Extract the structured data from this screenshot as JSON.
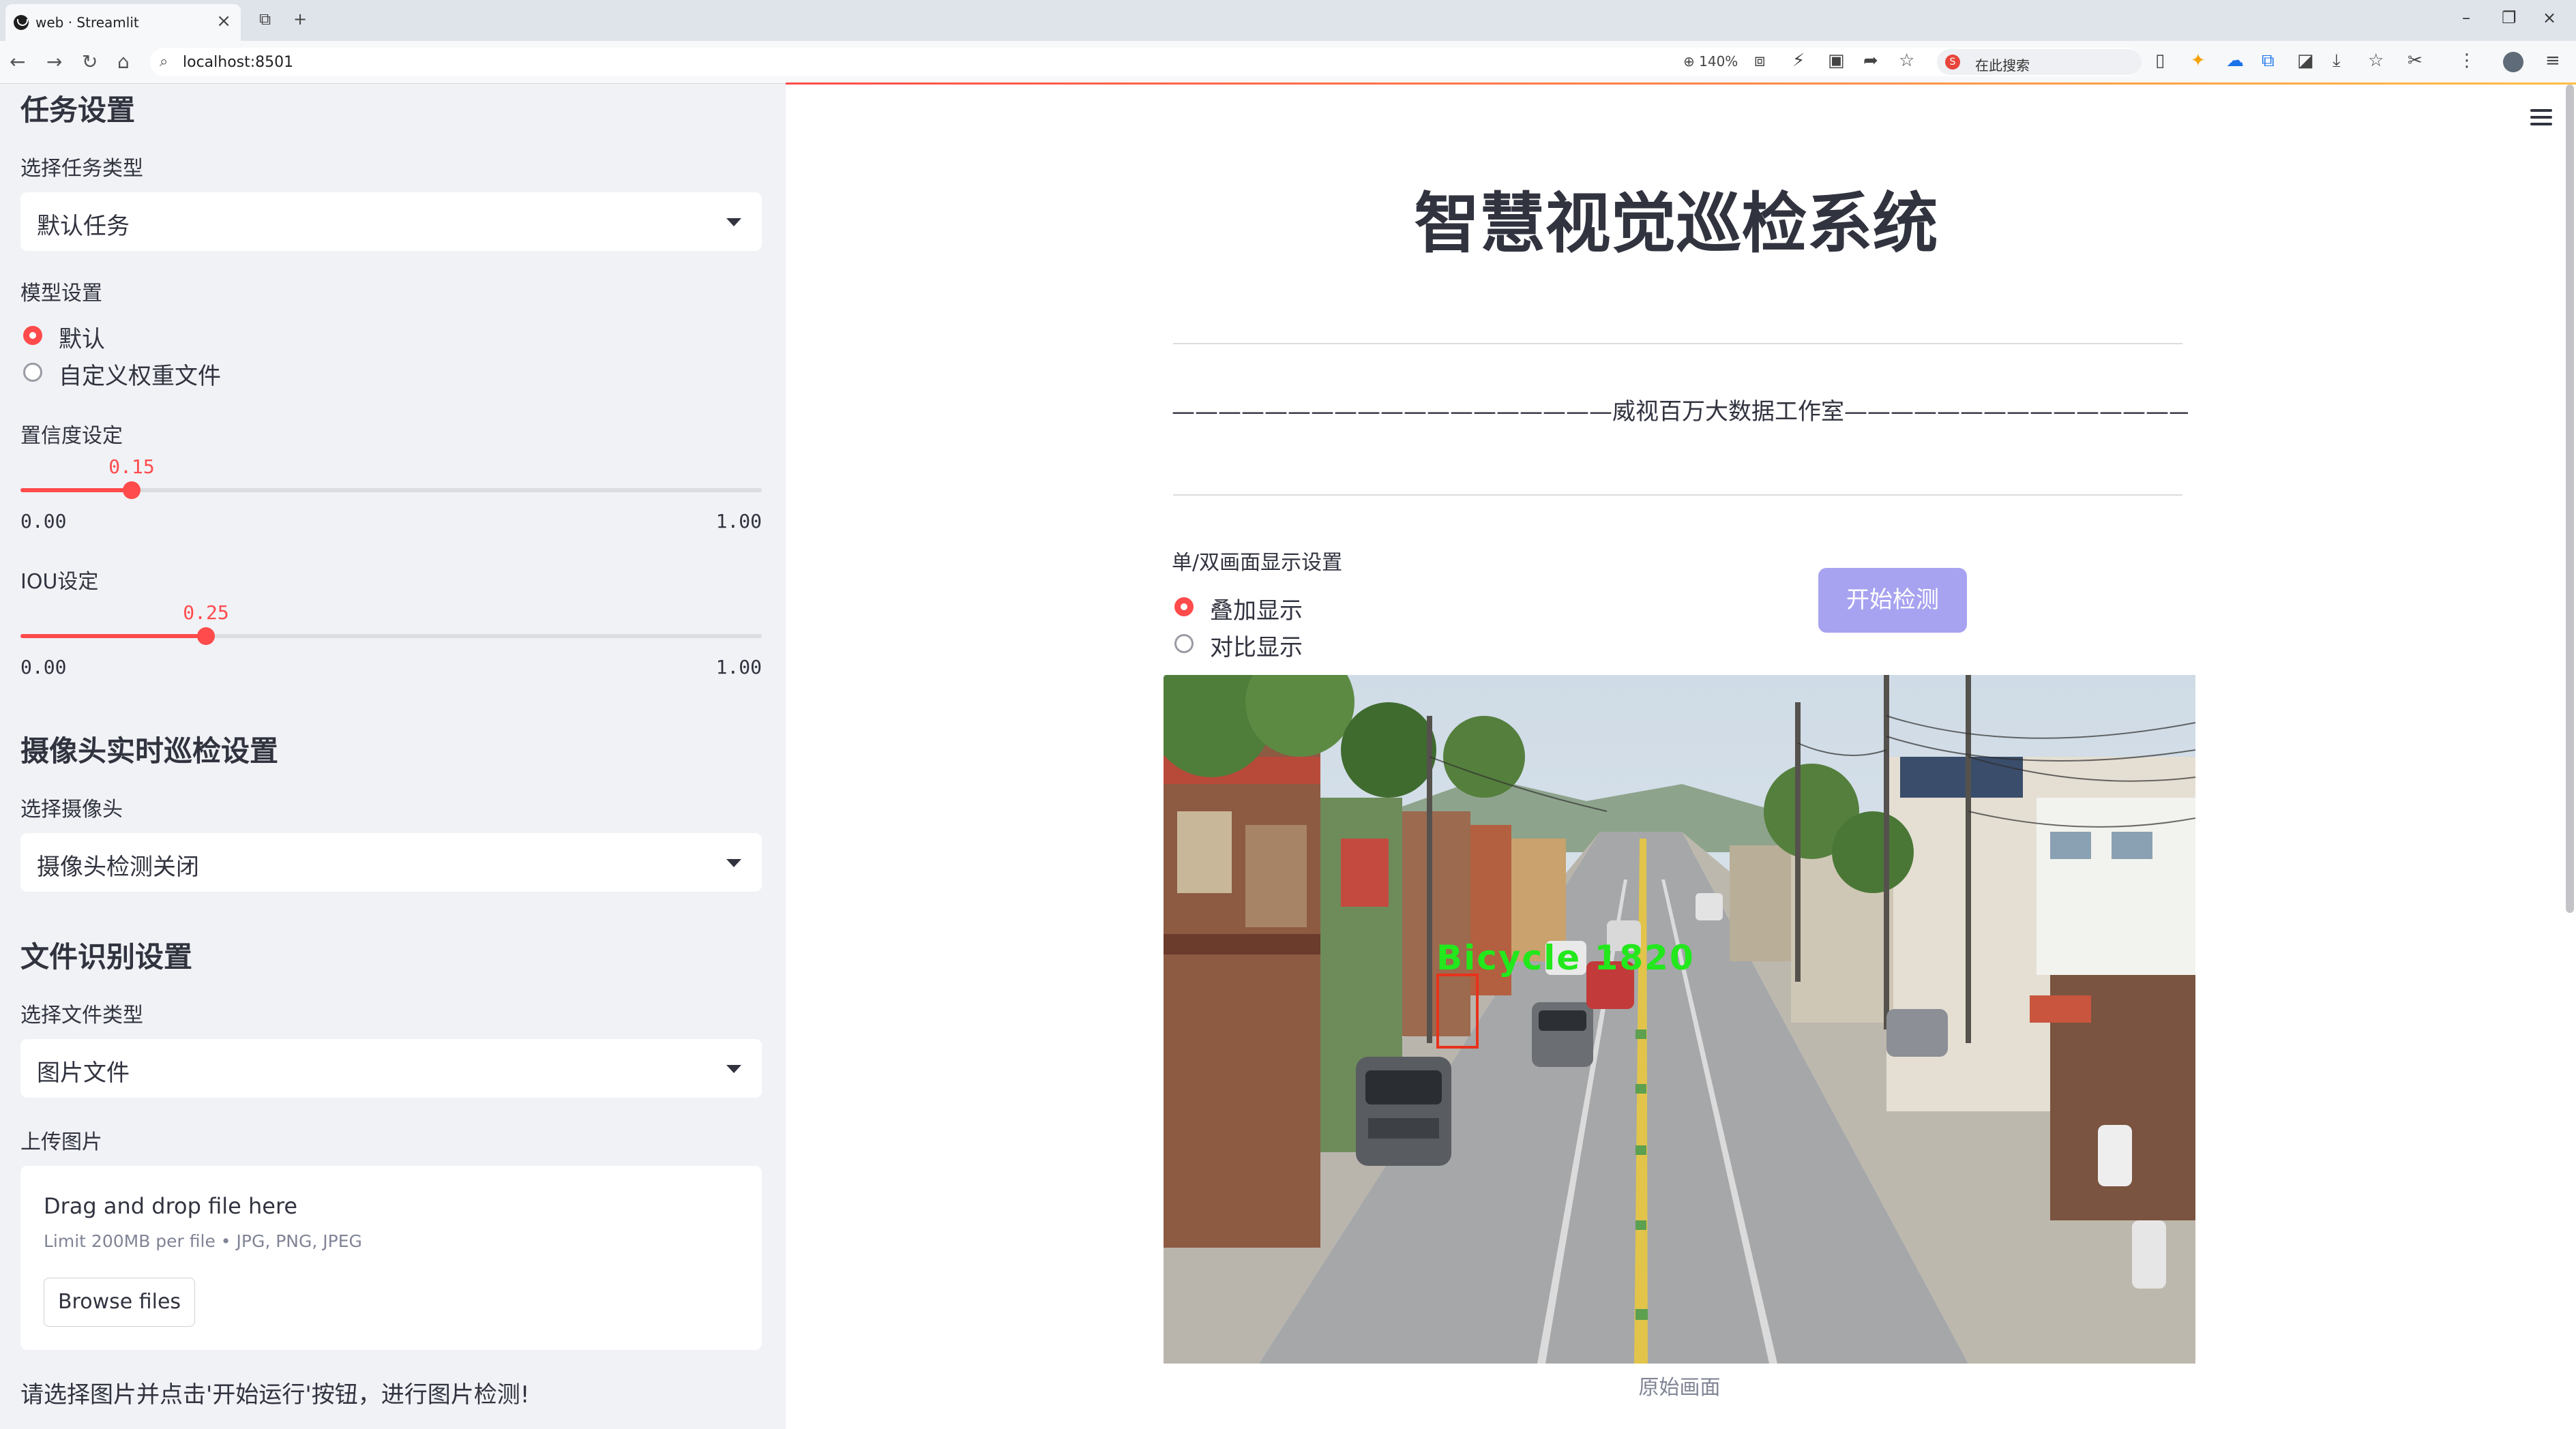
{
  "browser": {
    "tab_title": "web · Streamlit",
    "url": "localhost:8501",
    "zoom": "140%",
    "search_placeholder": "在此搜索"
  },
  "sidebar": {
    "task_heading": "任务设置",
    "task_type_label": "选择任务类型",
    "task_type_value": "默认任务",
    "model_label": "模型设置",
    "model_options": [
      "默认",
      "自定义权重文件"
    ],
    "model_selected": "默认",
    "confidence": {
      "label": "置信度设定",
      "value": "0.15",
      "min": "0.00",
      "max": "1.00",
      "fraction": 0.15
    },
    "iou": {
      "label": "IOU设定",
      "value": "0.25",
      "min": "0.00",
      "max": "1.00",
      "fraction": 0.25
    },
    "camera_heading": "摄像头实时巡检设置",
    "camera_label": "选择摄像头",
    "camera_value": "摄像头检测关闭",
    "file_heading": "文件识别设置",
    "file_type_label": "选择文件类型",
    "file_type_value": "图片文件",
    "upload_label": "上传图片",
    "uploader": {
      "drag_text": "Drag and drop file here",
      "limit_text": "Limit 200MB per file • JPG, PNG, JPEG",
      "browse_label": "Browse files"
    },
    "note": "请选择图片并点击'开始运行'按钮，进行图片检测!"
  },
  "main": {
    "title": "智慧视觉巡检系统",
    "studio_line": "———————————————————威视百万大数据工作室————————————————————",
    "display_label": "单/双画面显示设置",
    "display_options": [
      "叠加显示",
      "对比显示"
    ],
    "display_selected": "叠加显示",
    "start_button": "开始检测",
    "detection_label": "Bicycle 1820",
    "image_caption": "原始画面"
  },
  "colors": {
    "accent": "#ff4b4b",
    "sidebar_bg": "#f0f2f6",
    "button_bg": "#a8a3f0",
    "detection_text": "#22e81c",
    "detection_box": "#e8321c"
  }
}
